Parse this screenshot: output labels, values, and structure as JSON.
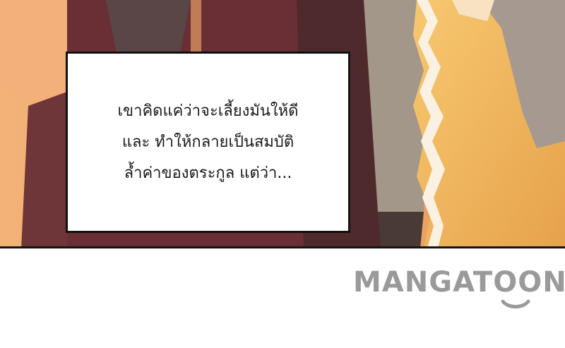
{
  "caption": {
    "lines": [
      "เขาคิดแค่ว่าจะเลี้ยงมันให้ดี",
      "และ ทำให้กลายเป็นสมบัติ",
      "ล้ำค่าของตระกูล แต่ว่า..."
    ]
  },
  "watermark": {
    "brand": "MANGATOON",
    "icon": "smile-icon",
    "color": "#9a9a9a"
  },
  "colors": {
    "skin": "#f2a86a",
    "robe_orange": "#f0b45a",
    "robe_dark": "#6a2f34",
    "gray_cloth": "#a39789",
    "border": "#111111"
  }
}
